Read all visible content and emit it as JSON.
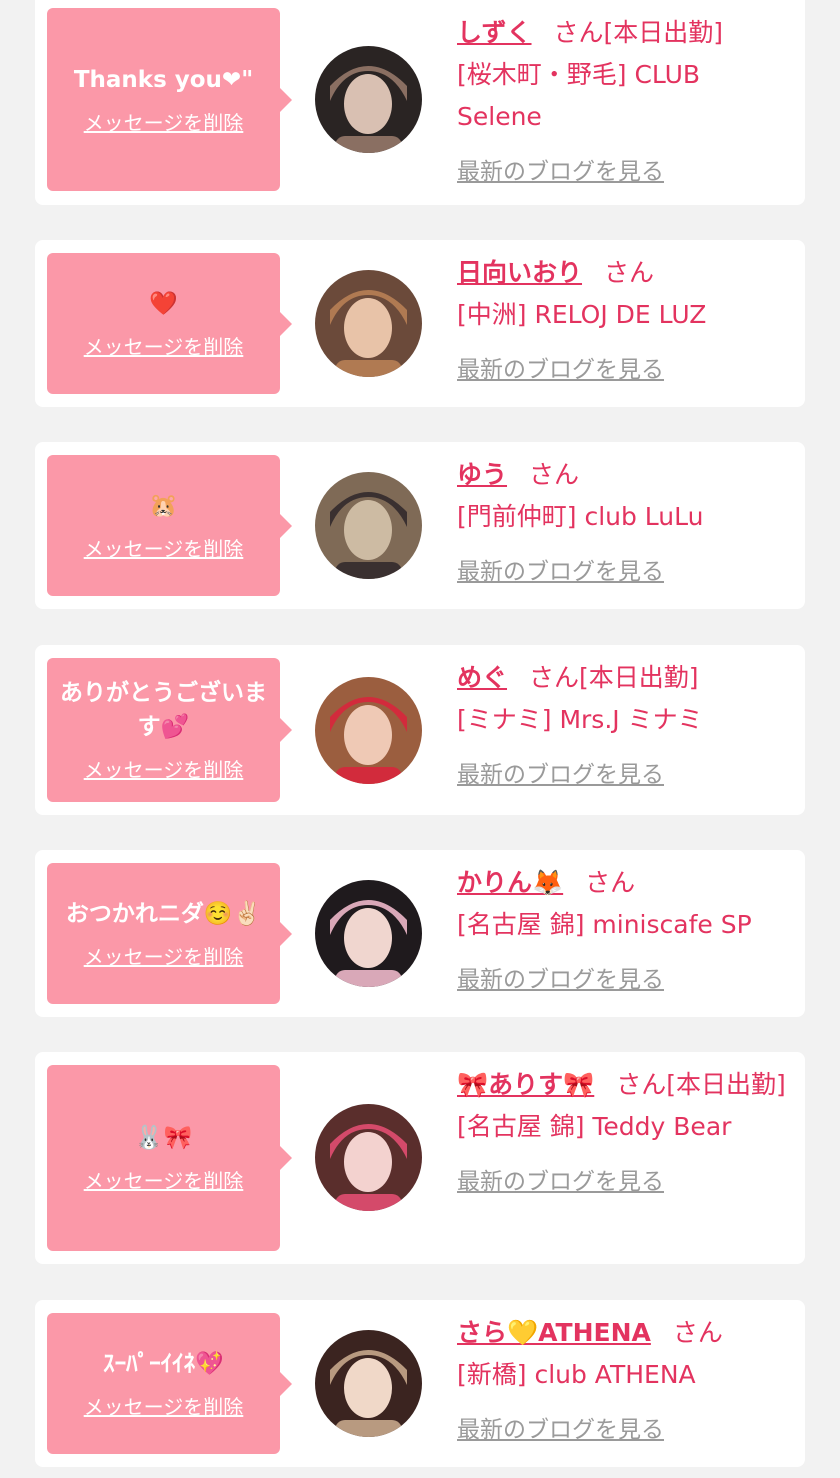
{
  "items": [
    {
      "message": "Thanks you❤\"",
      "delete_label": "メッセージを削除",
      "name": "しずく",
      "honorific": "さん",
      "status": "[本日出勤]",
      "location": "[桜木町・野毛] CLUB Selene",
      "blog_label": "最新のブログを見る",
      "avatar_palette": [
        "#2a2423",
        "#d9c0b2",
        "#8a6f62"
      ]
    },
    {
      "message": "❤️",
      "delete_label": "メッセージを削除",
      "name": "日向いおり",
      "honorific": "さん",
      "status": "",
      "location": "[中洲] RELOJ DE LUZ",
      "blog_label": "最新のブログを見る",
      "avatar_palette": [
        "#6b4a3a",
        "#e8c3a8",
        "#b07a52"
      ]
    },
    {
      "message": "🐹",
      "delete_label": "メッセージを削除",
      "name": "ゆう",
      "honorific": "さん",
      "status": "",
      "location": "[門前仲町] club LuLu",
      "blog_label": "最新のブログを見る",
      "avatar_palette": [
        "#7f6a56",
        "#cdbba3",
        "#3a3030"
      ]
    },
    {
      "message": "ありがとうございます💕",
      "delete_label": "メッセージを削除",
      "name": "めぐ",
      "honorific": "さん",
      "status": "[本日出勤]",
      "location": "[ミナミ] Mrs.J ミナミ",
      "blog_label": "最新のブログを見る",
      "avatar_palette": [
        "#9b5e3f",
        "#efc9b5",
        "#d22b3c"
      ]
    },
    {
      "message": "おつかれニダ☺️✌🏻",
      "delete_label": "メッセージを削除",
      "name": "かりん🦊",
      "honorific": "さん",
      "status": "",
      "location": "[名古屋 錦] miniscafe SP",
      "blog_label": "最新のブログを見る",
      "avatar_palette": [
        "#1f1a1d",
        "#f0d6cf",
        "#d9a8b8"
      ]
    },
    {
      "message": "🐰🎀",
      "delete_label": "メッセージを削除",
      "name": "🎀ありす🎀",
      "honorific": "さん",
      "status": "[本日出勤]",
      "location": "[名古屋 錦] Teddy Bear",
      "blog_label": "最新のブログを見る",
      "avatar_palette": [
        "#5a2e2c",
        "#f3d2cf",
        "#d44a6a"
      ]
    },
    {
      "message": "ｽｰﾊﾟｰｲｲﾈ💖",
      "delete_label": "メッセージを削除",
      "name": "さら💛ATHENA",
      "honorific": "さん",
      "status": "",
      "location": "[新橋] club ATHENA",
      "blog_label": "最新のブログを見る",
      "avatar_palette": [
        "#3b2420",
        "#f0d8c8",
        "#b89a80"
      ]
    }
  ],
  "colors": {
    "accent": "#e3335f",
    "bubble": "#fb98a8",
    "blog_link": "#9a9a9a",
    "background": "#f2f2f2"
  }
}
